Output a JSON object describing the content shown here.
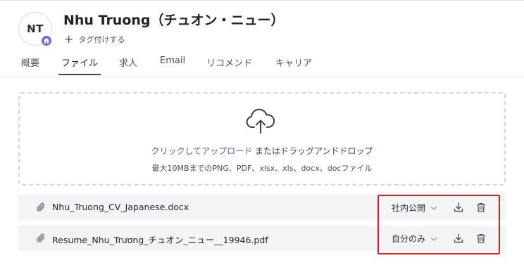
{
  "candidate": {
    "initials": "NT",
    "name": "Nhu Truong（チュオン・ニュー）",
    "add_tag_label": "タグ付けする"
  },
  "tabs": [
    {
      "label": "概要"
    },
    {
      "label": "ファイル",
      "active": true
    },
    {
      "label": "求人"
    },
    {
      "label": "Email"
    },
    {
      "label": "リコメンド"
    },
    {
      "label": "キャリア"
    }
  ],
  "upload": {
    "link_text": "クリックしてアップロード",
    "rest_text": " またはドラッグアンドドロップ",
    "hint": "最大10MBまでのPNG、PDF、xlsx、xls、docx、docファイル"
  },
  "files": [
    {
      "name": "Nhu_Truong_CV_Japanese.docx",
      "visibility": "社内公開"
    },
    {
      "name": "Resume_Nhu_Trương_チュオン_ニュー__19946.pdf",
      "visibility": "自分のみ"
    }
  ],
  "colors": {
    "accent": "#5b55d6",
    "avatar_badge": "#7b61e8",
    "highlight": "#d9201f",
    "row_bg": "#f3f4f6"
  },
  "icons": {
    "avatar_badge": "home-icon",
    "add_tag": "plus-icon",
    "upload": "cloud-upload-icon",
    "attachment": "paperclip-icon",
    "dropdown": "chevron-down-icon",
    "download": "download-icon",
    "delete": "trash-icon"
  }
}
